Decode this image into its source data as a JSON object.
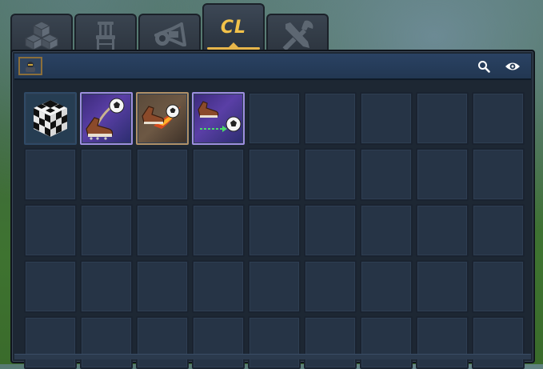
{
  "tabs": [
    {
      "name": "blocks",
      "icon": "blocks-icon",
      "active": false
    },
    {
      "name": "furniture",
      "icon": "chair-icon",
      "active": false
    },
    {
      "name": "toys",
      "icon": "horn-icon",
      "active": false
    },
    {
      "name": "cl",
      "label": "CL",
      "icon": "",
      "active": true
    },
    {
      "name": "tools",
      "icon": "tools-icon",
      "active": false
    }
  ],
  "header": {
    "filter_icon": "character-filter-icon",
    "search_icon": "magnifier-icon",
    "view_icon": "eye-icon"
  },
  "inventory": {
    "columns": 9,
    "visible_rows": 5,
    "items": [
      {
        "name": "football-block",
        "icon": "checkered-cube-icon",
        "frame": "cube-bg"
      },
      {
        "name": "overhead-kick",
        "icon": "boot-kick-ball-icon",
        "frame": "purple"
      },
      {
        "name": "fire-shot",
        "icon": "boot-fireball-icon",
        "frame": "bronze"
      },
      {
        "name": "long-pass",
        "icon": "boot-pass-ball-icon",
        "frame": "purple"
      }
    ]
  },
  "colors": {
    "accent": "#e6b54a",
    "panel": "#1d2733",
    "header": "#2a4263",
    "slot": "#263446"
  }
}
